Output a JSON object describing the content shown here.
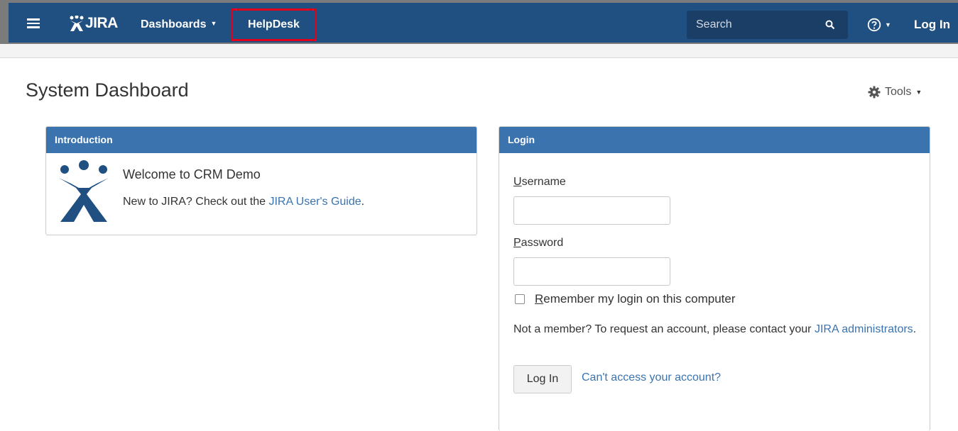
{
  "header": {
    "logo_text": "JIRA",
    "nav": {
      "dashboards": "Dashboards",
      "helpdesk": "HelpDesk"
    },
    "search": {
      "placeholder": "Search"
    },
    "login": "Log In",
    "colors": {
      "bar": "#205081",
      "highlight_border": "#e2001a"
    }
  },
  "page": {
    "title": "System Dashboard",
    "tools": "Tools"
  },
  "introduction": {
    "header": "Introduction",
    "welcome": "Welcome to CRM Demo",
    "new_to_prefix": "New to JIRA? Check out the ",
    "guide_link": "JIRA User's Guide",
    "new_to_suffix": "."
  },
  "login_gadget": {
    "header": "Login",
    "username": {
      "accesskey": "U",
      "rest": "sername"
    },
    "password": {
      "accesskey": "P",
      "rest": "assword"
    },
    "remember": {
      "accesskey": "R",
      "rest": "emember my login on this computer"
    },
    "not_member_text": "Not a member? To request an account, please contact your ",
    "admin_link": "JIRA administrators",
    "not_member_suffix": ".",
    "login_button": "Log In",
    "cant_access": "Can't access your account?"
  },
  "icons": [
    "menu-icon",
    "jira-logo-icon",
    "search-icon",
    "help-icon",
    "gear-icon",
    "jira-mascot-icon"
  ]
}
